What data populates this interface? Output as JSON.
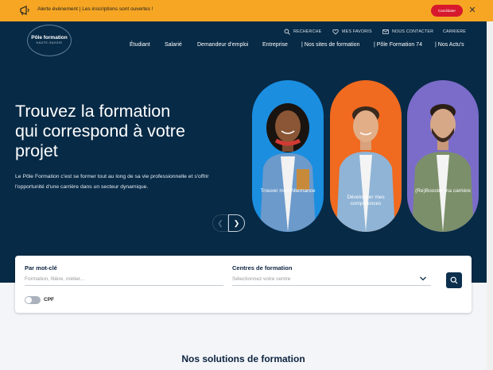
{
  "alert": {
    "text": "Alerte événement  |  Les inscriptions sont ouvertes !",
    "button": "Candidater",
    "close": "✕"
  },
  "logo": {
    "name": "Pôle formation",
    "sub": "HAUTE-SAVOIE"
  },
  "utility": [
    "RECHERCHE",
    "MES FAVORIS",
    "NOUS CONTACTER",
    "CARRIERE"
  ],
  "nav": [
    "Étudiant",
    "Salarié",
    "Demandeur d'emploi",
    "Entreprise",
    "| Nos sites de formation",
    "| Pôle Formation 74",
    "| Nos Actu's"
  ],
  "hero": {
    "title_lines": [
      "Trouvez la formation",
      "qui correspond à votre",
      "projet"
    ],
    "description": "Le Pôle Formation c'est se former tout au long de sa vie professionnelle et s'offrir l'opportunité d'une carrière dans un secteur dynamique."
  },
  "cards": [
    {
      "label": "Trouver mon Alternance",
      "color": "#1b8ee0"
    },
    {
      "label": "Développer mes compétences",
      "color": "#f06a1f"
    },
    {
      "label": "(Re)Booster ma carrière",
      "color": "#7b6cc9"
    }
  ],
  "carousel": {
    "prev": "❮",
    "next": "❯"
  },
  "search": {
    "keyword_label": "Par mot-clé",
    "keyword_placeholder": "Formation, filière, métier...",
    "centre_label": "Centres de formation",
    "centre_placeholder": "Sélectionnez votre centre",
    "cpf_label": "CPF"
  },
  "solutions_title": "Nos solutions de formation",
  "colors": {
    "navy": "#072a46",
    "alert": "#f6a623",
    "cta": "#d7192d"
  }
}
